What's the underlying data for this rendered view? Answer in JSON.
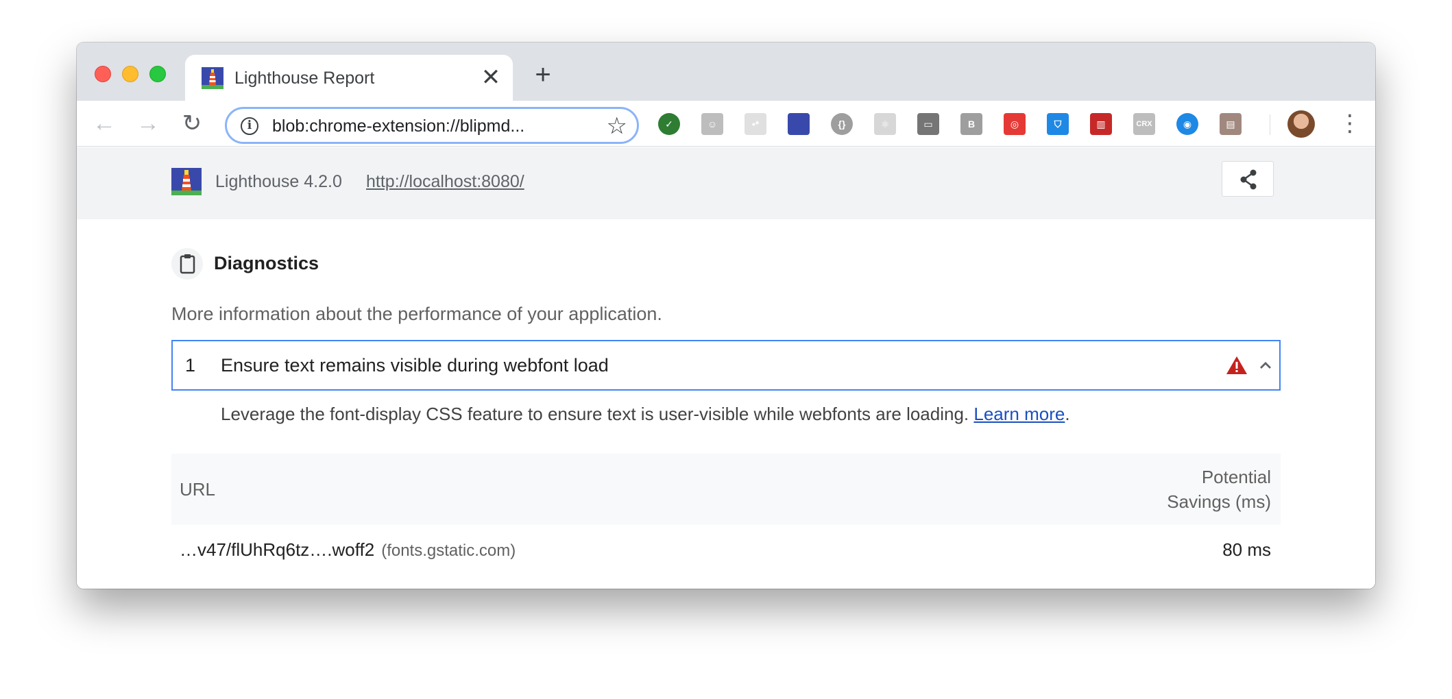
{
  "browser": {
    "tab_title": "Lighthouse Report",
    "tab_close": "✕",
    "new_tab": "+",
    "address": "blob:chrome-extension://blipmd...",
    "nav": {
      "back": "←",
      "forward": "→",
      "reload": "↻"
    },
    "star": "☆",
    "kebab": "⋮",
    "extensions": [
      {
        "name": "grammarly-check-icon",
        "color": "#2e7d32",
        "label": "✓"
      },
      {
        "name": "ghost-extension-icon",
        "color": "#bdbdbd",
        "label": "☺"
      },
      {
        "name": "placeholder-extension-icon",
        "color": "#e0e0e0",
        "label": "•*"
      },
      {
        "name": "lighthouse-extension-icon",
        "color": "#3949ab",
        "label": ""
      },
      {
        "name": "json-viewer-icon",
        "color": "#9e9e9e",
        "label": "{}"
      },
      {
        "name": "react-devtools-icon",
        "color": "#d7d7d7",
        "label": "⚛"
      },
      {
        "name": "laptop-icon",
        "color": "#757575",
        "label": "▭"
      },
      {
        "name": "bootstrap-b-icon",
        "color": "#9e9e9e",
        "label": "B"
      },
      {
        "name": "spiral-target-icon",
        "color": "#e53935",
        "label": "◎"
      },
      {
        "name": "shield-icon",
        "color": "#1e88e5",
        "label": "⛉"
      },
      {
        "name": "sd-card-icon",
        "color": "#c62828",
        "label": "▥"
      },
      {
        "name": "crx-icon",
        "color": "#bdbdbd",
        "label": "CRX"
      },
      {
        "name": "privacy-badger-icon",
        "color": "#1e88e5",
        "label": "◉"
      },
      {
        "name": "book-icon",
        "color": "#a1887f",
        "label": "▤"
      }
    ]
  },
  "lighthouse": {
    "version": "Lighthouse 4.2.0",
    "url": "http://localhost:8080/"
  },
  "diagnostics": {
    "title": "Diagnostics",
    "description": "More information about the performance of your application.",
    "audit": {
      "index": "1",
      "title": "Ensure text remains visible during webfont load",
      "description": "Leverage the font-display CSS feature to ensure text is user-visible while webfonts are loading.",
      "learn_more": "Learn more",
      "trailing_period": "."
    },
    "table": {
      "col_url": "URL",
      "col_savings_line1": "Potential",
      "col_savings_line2": "Savings (ms)",
      "rows": [
        {
          "url": "…v47/flUhRq6tz….woff2",
          "host": "(fonts.gstatic.com)",
          "savings": "80 ms"
        }
      ]
    }
  },
  "colors": {
    "tabstrip": "#dee1e6",
    "focus_border": "#4285f4",
    "warning": "#c5221f",
    "link": "#1a4fbf"
  }
}
